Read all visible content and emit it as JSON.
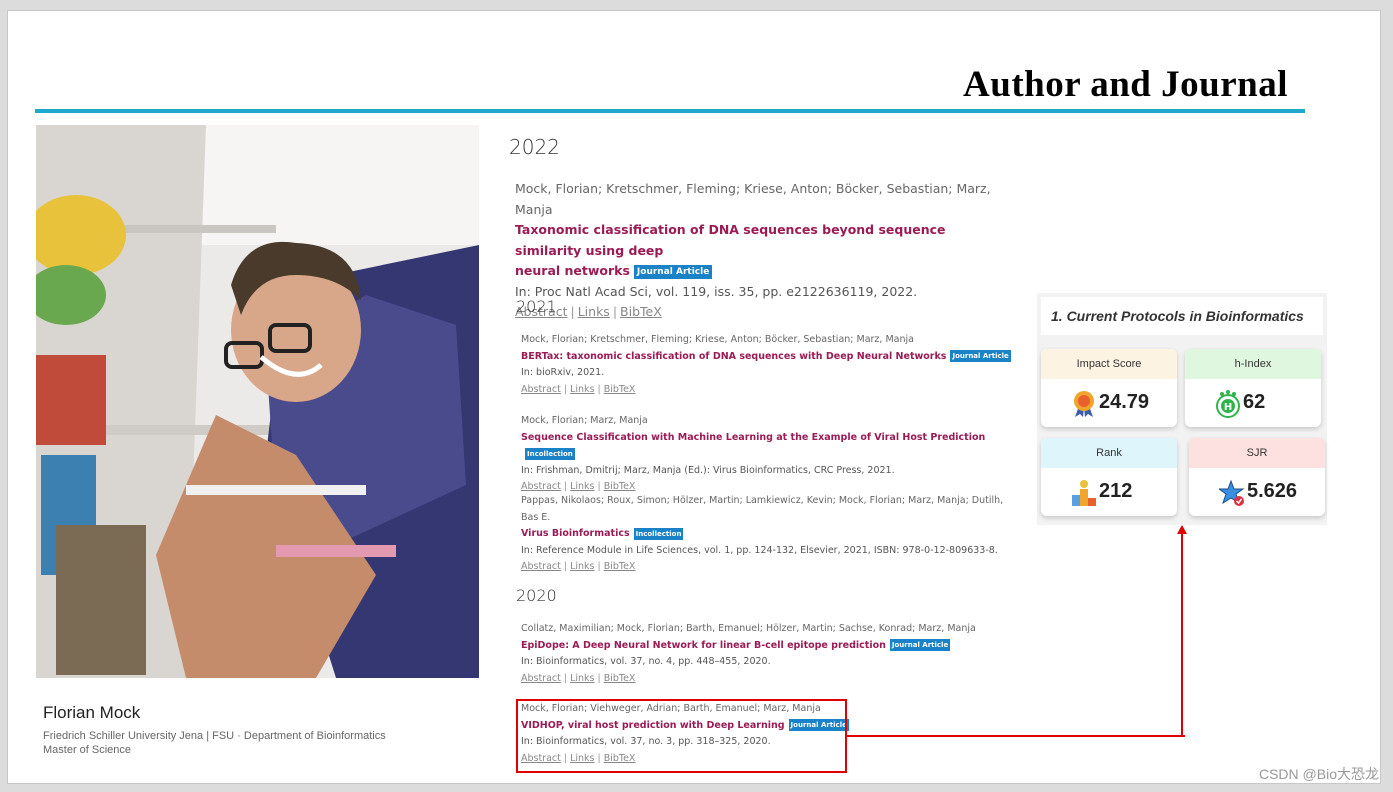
{
  "slide": {
    "title": "Author and Journal",
    "accent_color": "#1ea9cc"
  },
  "profile": {
    "name": "Florian Mock",
    "affiliation": "Friedrich Schiller University Jena | FSU · Department of Bioinformatics",
    "degree": "Master of Science"
  },
  "publications": {
    "year_2022": "2022",
    "year_2021": "2021",
    "year_2020": "2020",
    "links": {
      "abstract": "Abstract",
      "links": "Links",
      "bibtex": "BibTeX",
      "sep": "|"
    },
    "pub1": {
      "authors": "Mock, Florian; Kretschmer, Fleming; Kriese, Anton; Böcker, Sebastian; Marz, Manja",
      "title_line1": "Taxonomic classification of DNA sequences beyond sequence similarity using deep",
      "title_line2": "neural networks",
      "badge": "Journal Article",
      "venue": "In: Proc Natl Acad Sci, vol. 119, iss. 35, pp. e2122636119, 2022."
    },
    "pub2": {
      "authors": "Mock, Florian; Kretschmer, Fleming; Kriese, Anton; Böcker, Sebastian; Marz, Manja",
      "title": "BERTax: taxonomic classification of DNA sequences with Deep Neural Networks",
      "badge": "Journal Article",
      "venue": "In: bioRxiv, 2021."
    },
    "pub3": {
      "authors": "Mock, Florian; Marz, Manja",
      "title": "Sequence Classification with Machine Learning at the Example of Viral Host Prediction",
      "badge": "Incollection",
      "venue": "In: Frishman, Dmitrij; Marz, Manja (Ed.): Virus Bioinformatics, CRC Press, 2021."
    },
    "pub4": {
      "authors": "Pappas, Nikolaos; Roux, Simon; Hölzer, Martin; Lamkiewicz, Kevin; Mock, Florian; Marz, Manja; Dutilh, Bas E.",
      "title": "Virus Bioinformatics",
      "badge": "Incollection",
      "venue": "In: Reference Module in Life Sciences, vol. 1, pp. 124-132, Elsevier, 2021, ISBN: 978-0-12-809633-8."
    },
    "pub5": {
      "authors": "Collatz, Maximilian; Mock, Florian; Barth, Emanuel; Hölzer, Martin; Sachse, Konrad; Marz, Manja",
      "title": "EpiDope: A Deep Neural Network for linear B-cell epitope prediction",
      "badge": "Journal Article",
      "venue": "In: Bioinformatics, vol. 37, no. 4, pp. 448–455, 2020."
    },
    "pub6": {
      "authors": "Mock, Florian; Viehweger, Adrian; Barth, Emanuel; Marz, Manja",
      "title": "VIDHOP, viral host prediction with Deep Learning",
      "badge": "Journal Article",
      "venue": "In: Bioinformatics, vol. 37, no. 3, pp. 318–325, 2020."
    }
  },
  "journal_panel": {
    "heading": "1. Current Protocols in Bioinformatics",
    "impact": {
      "label": "Impact Score",
      "value": "24.79",
      "icon": "award-medal-icon",
      "color": "#fdf3e3"
    },
    "hindex": {
      "label": "h-Index",
      "value": "62",
      "icon": "h-star-badge-icon",
      "color": "#dff7df"
    },
    "rank": {
      "label": "Rank",
      "value": "212",
      "icon": "podium-icon",
      "color": "#def6fb"
    },
    "sjr": {
      "label": "SJR",
      "value": "5.626",
      "icon": "star-check-icon",
      "color": "#fde0e0"
    }
  },
  "highlight_color": "#e00000",
  "watermark": "CSDN @Bio大恐龙"
}
